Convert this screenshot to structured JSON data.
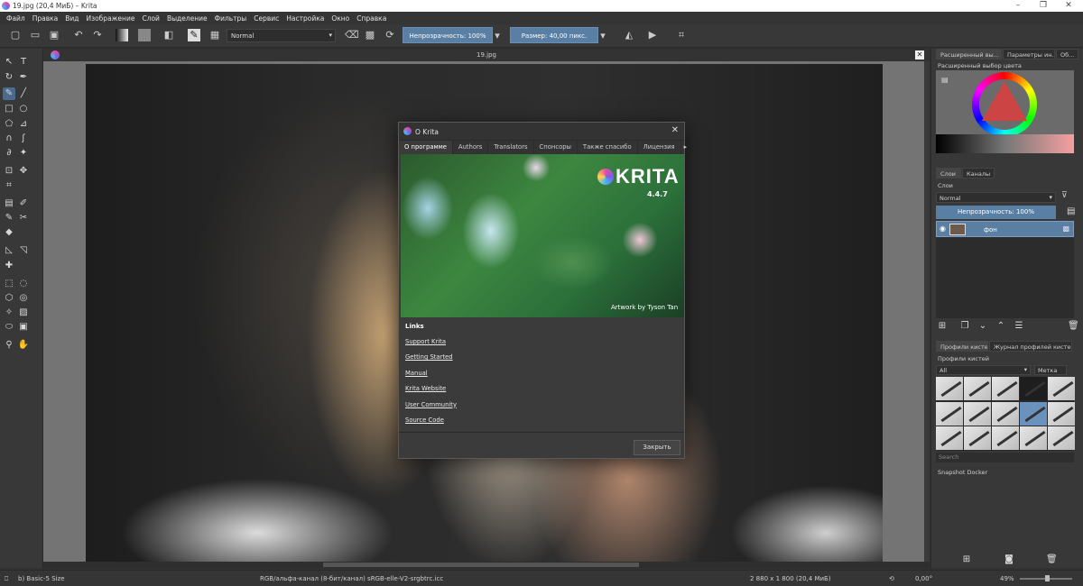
{
  "window": {
    "title": "19.jpg (20,4 МиБ)  – Krita"
  },
  "menu": [
    "Файл",
    "Правка",
    "Вид",
    "Изображение",
    "Слой",
    "Выделение",
    "Фильтры",
    "Сервис",
    "Настройка",
    "Окно",
    "Справка"
  ],
  "toolbar": {
    "blend_mode": "Normal",
    "opacity": "Непрозрачность: 100%",
    "size": "Размер: 40,00 пикс."
  },
  "canvas": {
    "tab_title": "19.jpg"
  },
  "dialog": {
    "title": "О Krita",
    "tabs": [
      "О программе",
      "Authors",
      "Translators",
      "Спонсоры",
      "Также спасибо",
      "Лицензия"
    ],
    "logo_text": "KRITA",
    "version": "4.4.7",
    "artwork_credit": "Artwork by Tyson Tan",
    "links_heading": "Links",
    "links": [
      "Support Krita",
      "Getting Started",
      "Manual",
      "Krita Website",
      "User Community",
      "Source Code"
    ],
    "close_label": "Закрыть"
  },
  "right_dock": {
    "top_tabs": [
      "Расширенный вы...",
      "Параметры ин...",
      "Об..."
    ],
    "color_title": "Расширенный выбор цвета",
    "layer_tabs": [
      "Слои",
      "Каналы"
    ],
    "layers_title": "Слои",
    "layer_blend": "Normal",
    "layer_opacity": "Непрозрачность:  100%",
    "layer_name": "фон",
    "brush_tabs": [
      "Профили кистей",
      "Журнал профилей кистей"
    ],
    "brush_title": "Профили кистей",
    "brush_filter": "All",
    "brush_tag": "Метка",
    "brush_search": "Search",
    "snapshot": "Snapshot Docker"
  },
  "status": {
    "brush": "b) Basic-5 Size",
    "color_space": "RGB/альфа-канал (8-бит/канал)  sRGB-elle-V2-srgbtrc.icc",
    "dimensions": "2 880 x 1 800 (20,4 МиБ)",
    "rotation": "0,00°",
    "zoom": "49%"
  }
}
